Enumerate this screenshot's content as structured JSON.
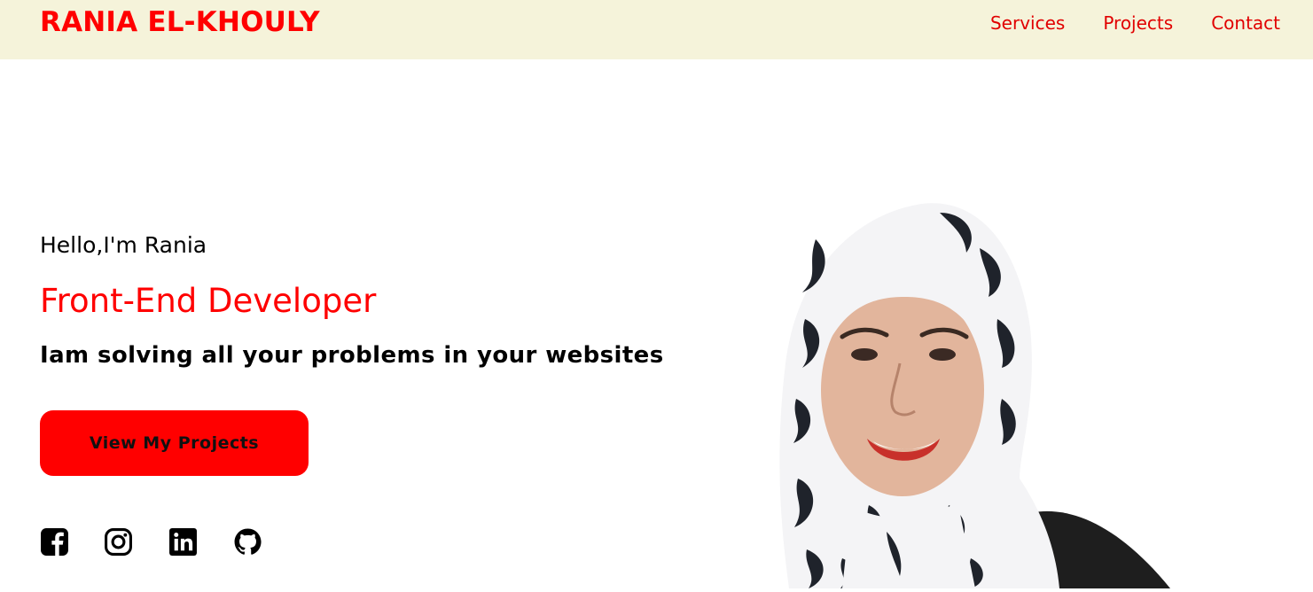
{
  "header": {
    "brand": "RANIA EL-KHOULY",
    "nav": [
      {
        "label": "Services"
      },
      {
        "label": "Projects"
      },
      {
        "label": "Contact"
      }
    ]
  },
  "hero": {
    "greeting": "Hello,I'm Rania",
    "role": "Front-End Developer",
    "tagline": "Iam solving all your problems in your websites",
    "cta_label": "View My Projects"
  },
  "socials": [
    {
      "icon": "facebook-icon"
    },
    {
      "icon": "instagram-icon"
    },
    {
      "icon": "linkedin-icon"
    },
    {
      "icon": "github-icon"
    }
  ],
  "colors": {
    "accent": "#ff0000",
    "header_bg": "#f5f3da",
    "text": "#000000"
  }
}
